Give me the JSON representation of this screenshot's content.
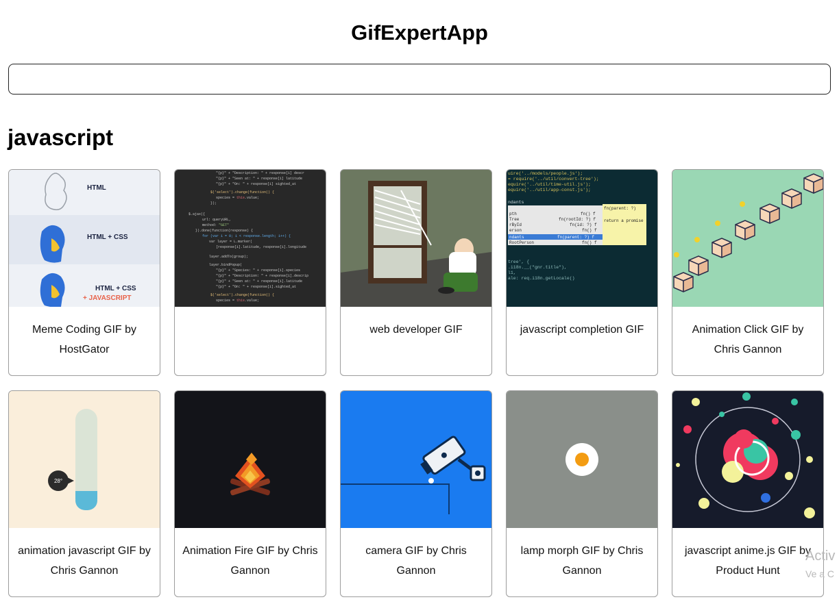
{
  "app": {
    "title": "GifExpertApp"
  },
  "search": {
    "value": "",
    "placeholder": ""
  },
  "category": {
    "title": "javascript"
  },
  "gifs": [
    {
      "title": "Meme Coding GIF by HostGator",
      "icon": "hostgator-html-css-js-icon"
    },
    {
      "title": "",
      "icon": "code-editor-icon"
    },
    {
      "title": "web developer GIF",
      "icon": "cartoon-window-blinds-icon"
    },
    {
      "title": "javascript completion GIF",
      "icon": "code-autocomplete-icon"
    },
    {
      "title": "Animation Click GIF by Chris Gannon",
      "icon": "boxes-staircase-icon"
    },
    {
      "title": "animation javascript GIF by Chris Gannon",
      "icon": "thermometer-icon"
    },
    {
      "title": "Animation Fire GIF by Chris Gannon",
      "icon": "campfire-icon"
    },
    {
      "title": "camera GIF by Chris Gannon",
      "icon": "security-camera-icon"
    },
    {
      "title": "lamp morph GIF by Chris Gannon",
      "icon": "lamp-dot-icon"
    },
    {
      "title": "javascript anime.js GIF by Product Hunt",
      "icon": "colorful-circles-icon"
    }
  ],
  "overlay": {
    "activate_line1": "Activ",
    "activate_line2": "Ve a C"
  },
  "colors": {
    "accent_blue": "#1a7bf0",
    "dark_code_bg": "#282828",
    "mint_green": "#9ad7b4"
  }
}
